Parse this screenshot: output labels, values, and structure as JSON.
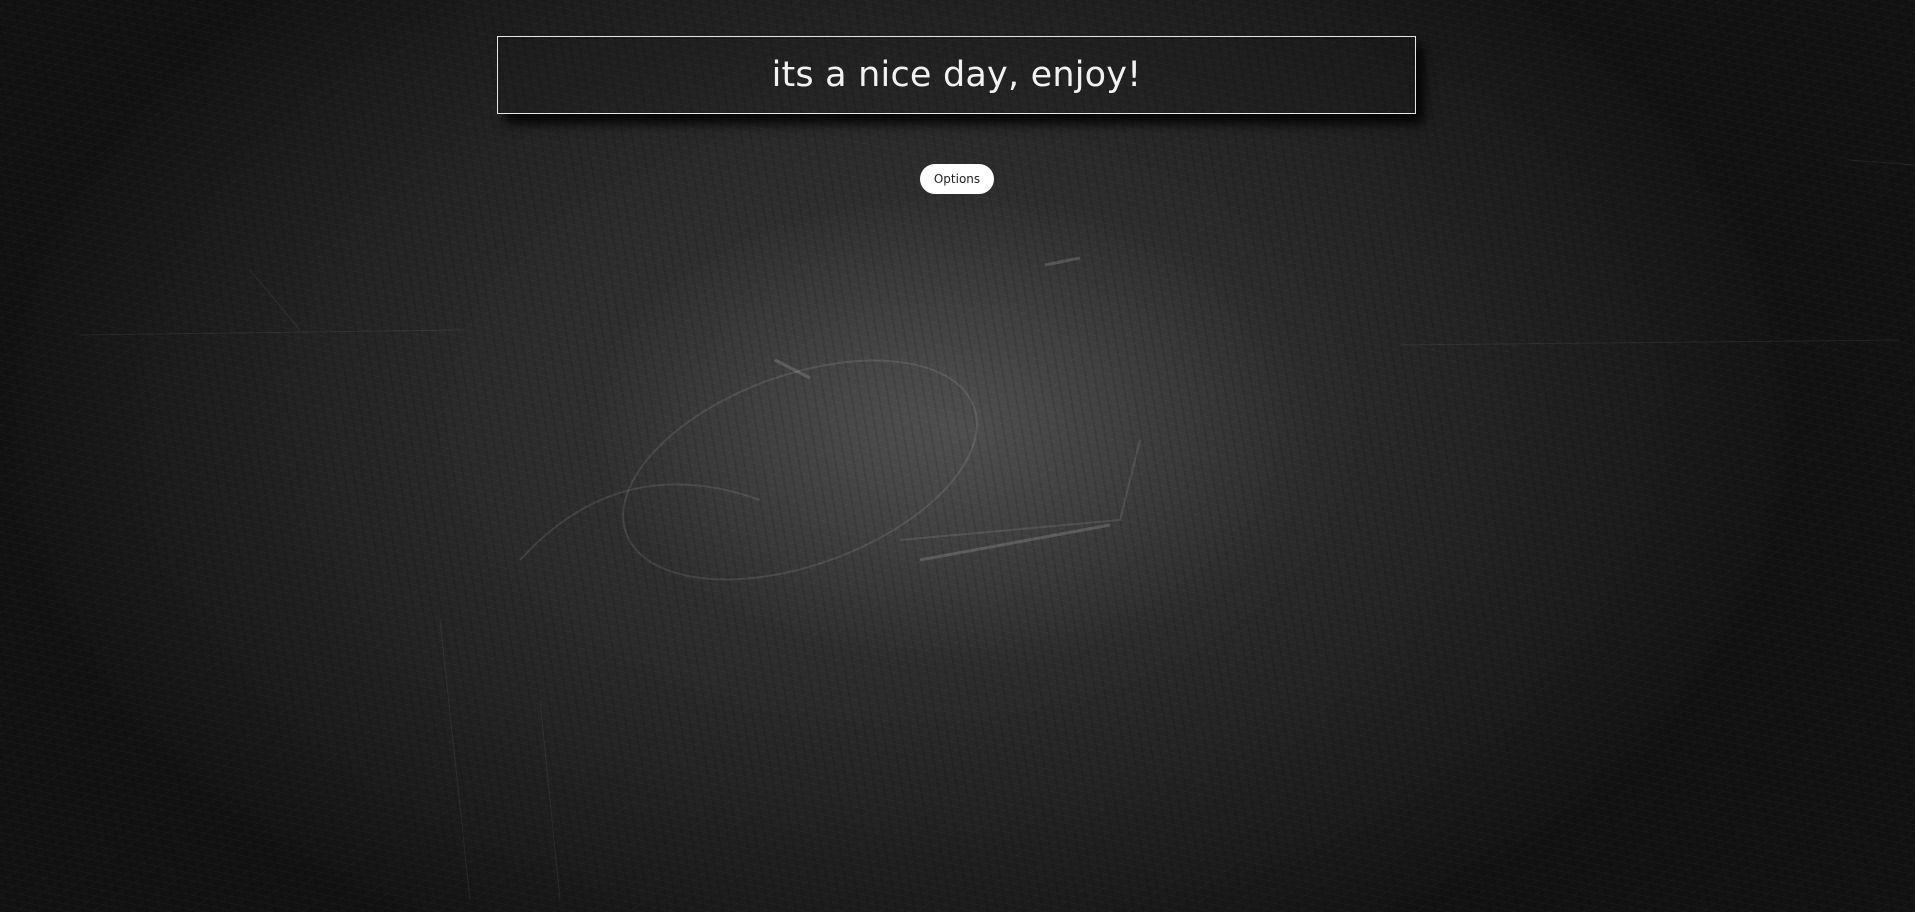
{
  "quote": {
    "text": "its a nice day, enjoy!"
  },
  "controls": {
    "options_label": "Options"
  },
  "theme": {
    "background": "chalkboard",
    "text_color": "#f2f2f2",
    "button_background": "#ffffff"
  }
}
